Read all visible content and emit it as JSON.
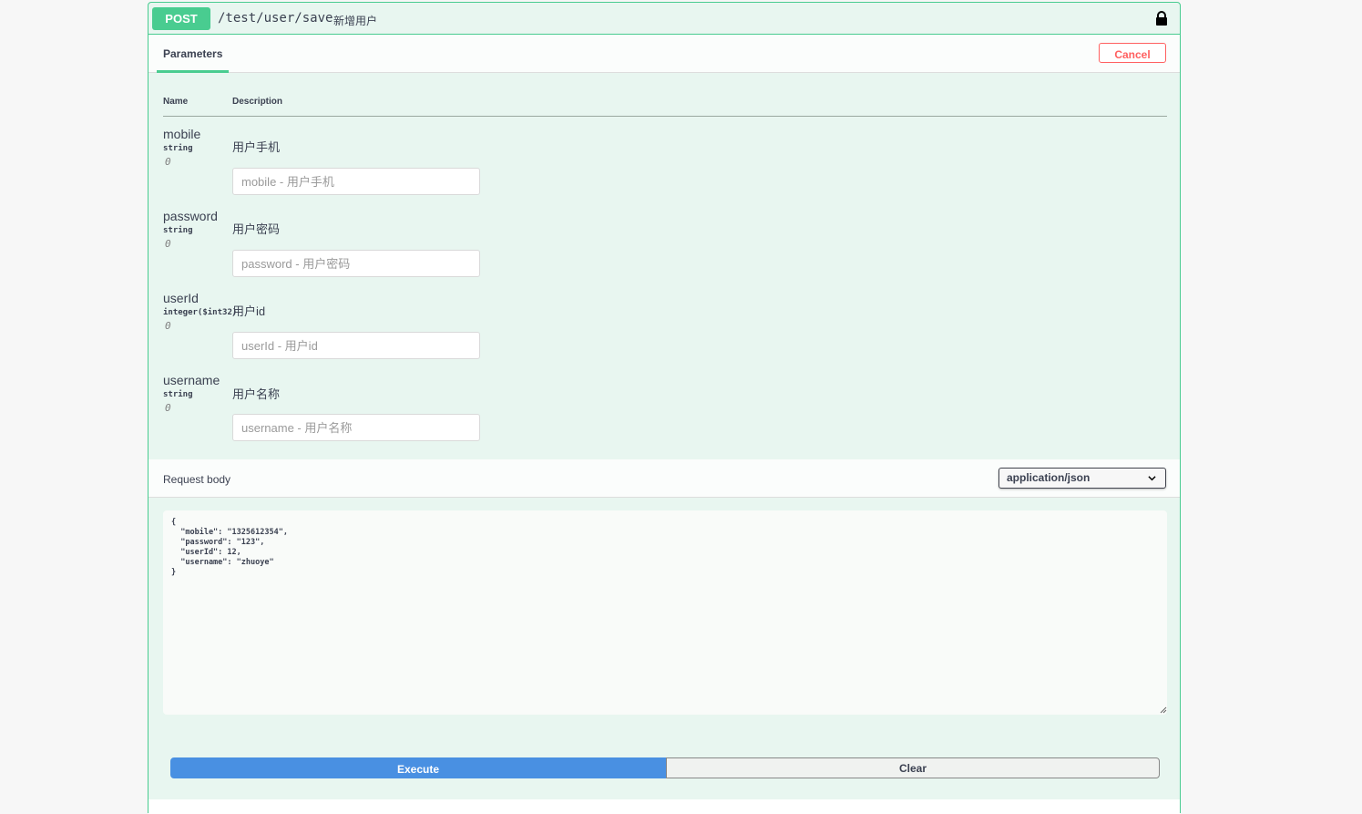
{
  "operation": {
    "method": "POST",
    "path": "/test/user/save",
    "summary": "新增用户",
    "lock_icon": "lock-icon"
  },
  "tabs": {
    "parameters": "Parameters",
    "cancel": "Cancel"
  },
  "table": {
    "name_header": "Name",
    "description_header": "Description"
  },
  "params": [
    {
      "name": "mobile",
      "type": "string",
      "in": "0",
      "description": "用户手机",
      "placeholder": "mobile - 用户手机"
    },
    {
      "name": "password",
      "type": "string",
      "in": "0",
      "description": "用户密码",
      "placeholder": "password - 用户密码"
    },
    {
      "name": "userId",
      "type": "integer($int32)",
      "in": "0",
      "description": "用户id",
      "placeholder": "userId - 用户id"
    },
    {
      "name": "username",
      "type": "string",
      "in": "0",
      "description": "用户名称",
      "placeholder": "username - 用户名称"
    }
  ],
  "request_body": {
    "label": "Request body",
    "content_type": "application/json",
    "body": "{\n  \"mobile\": \"1325612354\",\n  \"password\": \"123\",\n  \"userId\": 12,\n  \"username\": \"zhuoye\"\n}"
  },
  "actions": {
    "execute": "Execute",
    "clear": "Clear"
  },
  "colors": {
    "post_green": "#49cc90",
    "execute_blue": "#4990e2",
    "cancel_red": "#ff6060"
  }
}
